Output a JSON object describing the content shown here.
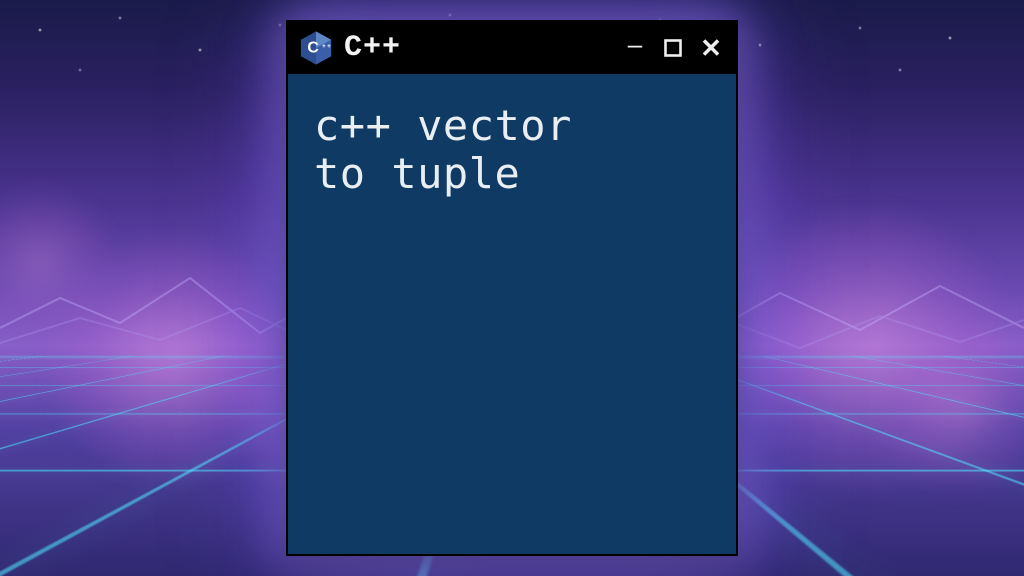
{
  "window": {
    "title": "C++",
    "icon_letter": "C",
    "icon_plus": "++",
    "controls": {
      "minimize": "–",
      "close": "✕"
    },
    "content_line1": "c++ vector",
    "content_line2": "to tuple"
  },
  "colors": {
    "window_bg": "#0e3a63",
    "titlebar_bg": "#000000",
    "badge_primary": "#3a5ea8",
    "badge_light": "#7aa0d8"
  }
}
